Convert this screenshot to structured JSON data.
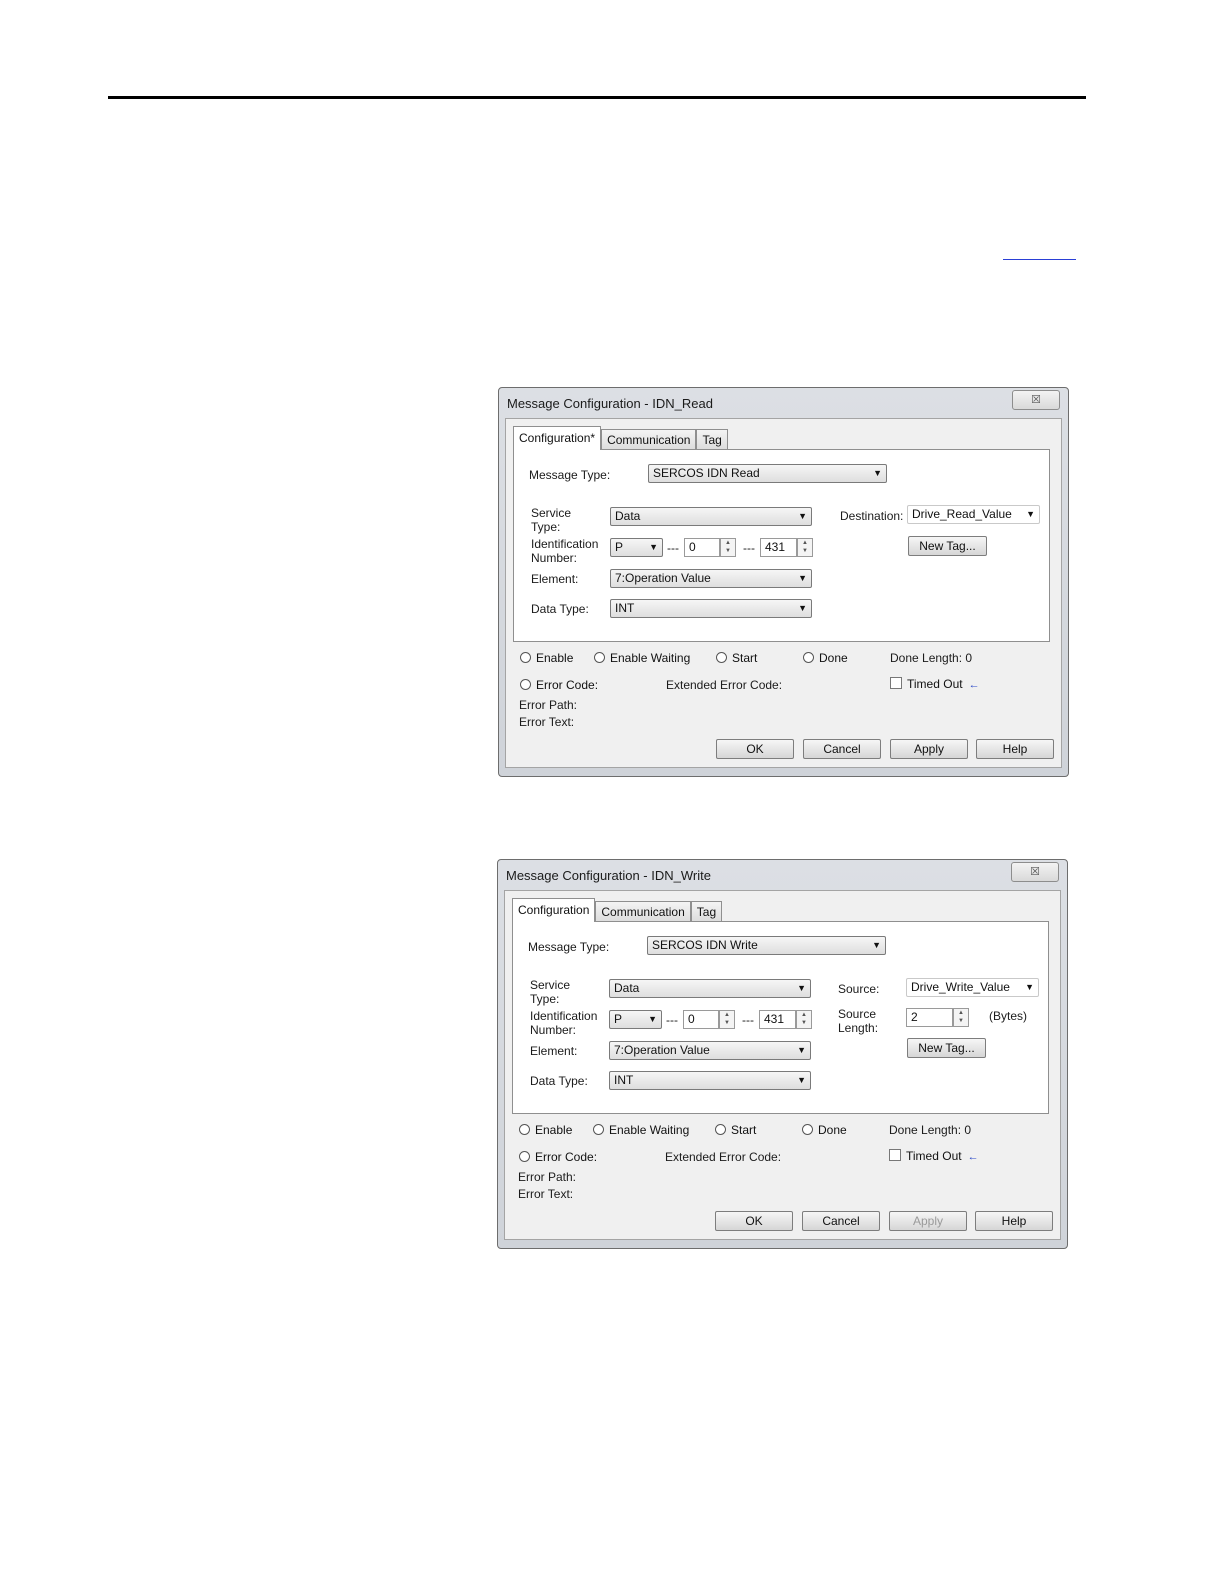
{
  "dialog_read": {
    "title": "Message Configuration - IDN_Read",
    "close": "☒",
    "tabs": [
      "Configuration*",
      "Communication",
      "Tag"
    ],
    "message_type_label": "Message Type:",
    "message_type": "SERCOS IDN Read",
    "service_type_label_1": "Service",
    "service_type_label_2": "Type:",
    "service_type": "Data",
    "id_label_1": "Identification",
    "id_label_2": "Number:",
    "id_set": "P",
    "dash": "---",
    "id_block": "0",
    "dash2": "---",
    "id_number": "431",
    "element_label": "Element:",
    "element": "7:Operation Value",
    "data_type_label": "Data Type:",
    "data_type": "INT",
    "destination_label": "Destination:",
    "destination": "Drive_Read_Value",
    "new_tag": "New Tag...",
    "enable": "Enable",
    "enable_waiting": "Enable Waiting",
    "start": "Start",
    "done": "Done",
    "done_length": "Done Length:  0",
    "error_code": "Error Code:",
    "extended_error_code": "Extended Error Code:",
    "timed_out": "Timed Out",
    "error_path": "Error Path:",
    "error_text": "Error Text:",
    "ok": "OK",
    "cancel": "Cancel",
    "apply": "Apply",
    "help": "Help"
  },
  "dialog_write": {
    "title": "Message Configuration - IDN_Write",
    "close": "☒",
    "tabs": [
      "Configuration",
      "Communication",
      "Tag"
    ],
    "message_type_label": "Message Type:",
    "message_type": "SERCOS IDN Write",
    "service_type_label_1": "Service",
    "service_type_label_2": "Type:",
    "service_type": "Data",
    "id_label_1": "Identification",
    "id_label_2": "Number:",
    "id_set": "P",
    "dash": "---",
    "id_block": "0",
    "dash2": "---",
    "id_number": "431",
    "element_label": "Element:",
    "element": "7:Operation Value",
    "data_type_label": "Data Type:",
    "data_type": "INT",
    "source_label": "Source:",
    "source": "Drive_Write_Value",
    "source_length_label_1": "Source",
    "source_length_label_2": "Length:",
    "source_length": "2",
    "bytes": "(Bytes)",
    "new_tag": "New Tag...",
    "enable": "Enable",
    "enable_waiting": "Enable Waiting",
    "start": "Start",
    "done": "Done",
    "done_length": "Done Length:  0",
    "error_code": "Error Code:",
    "extended_error_code": "Extended Error Code:",
    "timed_out": "Timed Out",
    "error_path": "Error Path:",
    "error_text": "Error Text:",
    "ok": "OK",
    "cancel": "Cancel",
    "apply": "Apply",
    "help": "Help"
  }
}
